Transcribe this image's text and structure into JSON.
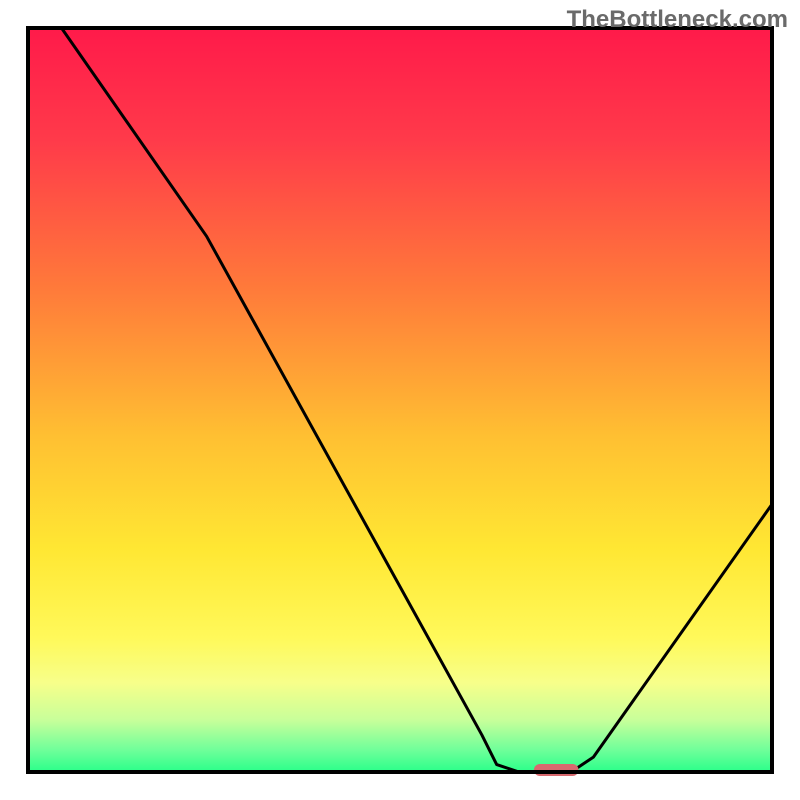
{
  "watermark": "TheBottleneck.com",
  "chart_data": {
    "type": "line",
    "title": "",
    "xlabel": "",
    "ylabel": "",
    "xlim": [
      0,
      100
    ],
    "ylim": [
      0,
      100
    ],
    "background": {
      "type": "vertical-gradient",
      "stops": [
        {
          "offset": 0.0,
          "color": "#ff1a4a"
        },
        {
          "offset": 0.15,
          "color": "#ff3a4a"
        },
        {
          "offset": 0.35,
          "color": "#ff7a3a"
        },
        {
          "offset": 0.55,
          "color": "#ffc032"
        },
        {
          "offset": 0.7,
          "color": "#ffe733"
        },
        {
          "offset": 0.82,
          "color": "#fff95a"
        },
        {
          "offset": 0.88,
          "color": "#f7ff8a"
        },
        {
          "offset": 0.93,
          "color": "#c8ff9a"
        },
        {
          "offset": 0.97,
          "color": "#70ff9a"
        },
        {
          "offset": 1.0,
          "color": "#2aff8a"
        }
      ]
    },
    "curve_points": [
      {
        "x": 4.5,
        "y": 100
      },
      {
        "x": 24,
        "y": 72
      },
      {
        "x": 61,
        "y": 5
      },
      {
        "x": 63,
        "y": 1
      },
      {
        "x": 66,
        "y": 0
      },
      {
        "x": 73,
        "y": 0
      },
      {
        "x": 76,
        "y": 2
      },
      {
        "x": 100,
        "y": 36
      }
    ],
    "marker": {
      "x_start": 68,
      "x_end": 74,
      "y": 0,
      "color": "#d8696f"
    },
    "frame_color": "#000000",
    "frame_width": 4,
    "curve_color": "#000000",
    "curve_width": 3
  }
}
